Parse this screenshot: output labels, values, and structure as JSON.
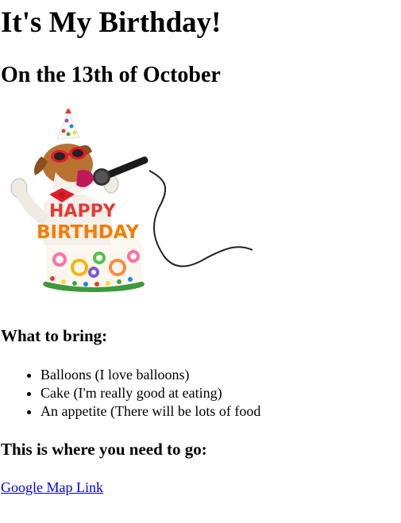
{
  "heading": "It's My Birthday!",
  "subheading": "On the 13th of October",
  "image": {
    "icon": "birthday-dog-singing-with-cake-photo",
    "cake_text_top": "HAPPY",
    "cake_text_bottom": "BIRTHDAY"
  },
  "bring_heading": "What to bring:",
  "bring_items": [
    "Balloons (I love balloons)",
    "Cake (I'm really good at eating)",
    "An appetite (There will be lots of food"
  ],
  "go_heading": "This is where you need to go:",
  "map_link": "Google Map Link",
  "colors": {
    "link": "#0000ee",
    "text": "#000000"
  }
}
